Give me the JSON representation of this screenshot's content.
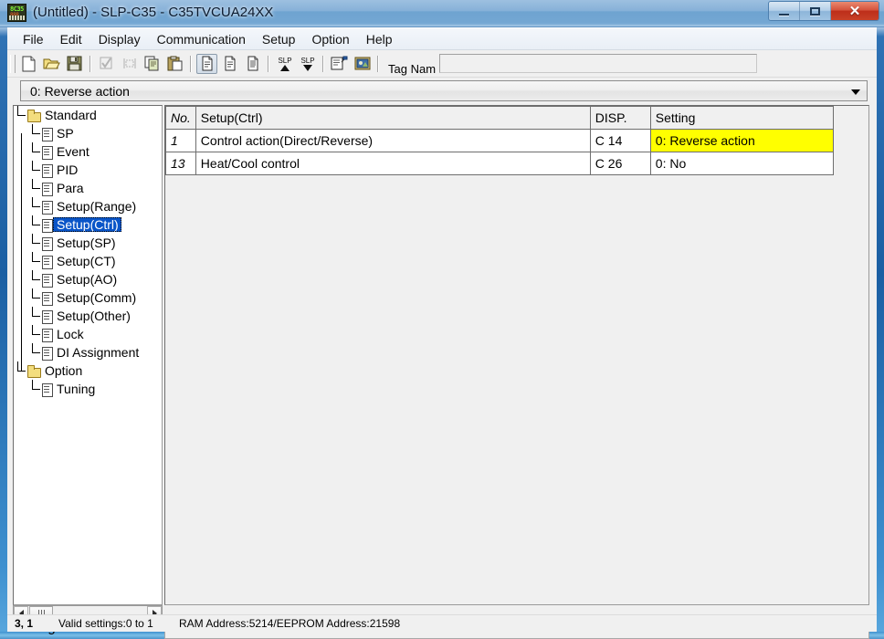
{
  "window": {
    "title": "(Untitled) - SLP-C35 - C35TVCUA24XX",
    "app_icon": "controller-display-icon",
    "icon_digits_top": "8C35",
    "icon_digits_bottom": "888",
    "minimize_label": "",
    "maximize_label": "",
    "close_label": "✕"
  },
  "menu": {
    "items": [
      {
        "label": "File"
      },
      {
        "label": "Edit"
      },
      {
        "label": "Display"
      },
      {
        "label": "Communication"
      },
      {
        "label": "Setup"
      },
      {
        "label": "Option"
      },
      {
        "label": "Help"
      }
    ]
  },
  "toolbar": {
    "buttons": [
      {
        "name": "new-file-icon"
      },
      {
        "name": "open-folder-icon"
      },
      {
        "name": "save-disk-icon"
      },
      {
        "name": "checkbox-icon"
      },
      {
        "name": "select-area-icon"
      },
      {
        "name": "copy-icon"
      },
      {
        "name": "paste-icon"
      },
      {
        "name": "document-active-icon"
      },
      {
        "name": "document-icon"
      },
      {
        "name": "document-lines-icon"
      },
      {
        "name": "slp-upload-icon"
      },
      {
        "name": "slp-download-icon"
      },
      {
        "name": "properties-icon"
      },
      {
        "name": "image-icon"
      }
    ],
    "tag_name_label": "Tag Nam",
    "tag_name_value": "",
    "tag_name_placeholder": ""
  },
  "combo": {
    "selected": "0: Reverse action",
    "arrow_icon": "chevron-down-icon"
  },
  "tree": {
    "nodes": [
      {
        "label": "Standard",
        "type": "folder",
        "level": 0,
        "selected": false
      },
      {
        "label": "SP",
        "type": "doc",
        "level": 1,
        "selected": false
      },
      {
        "label": "Event",
        "type": "doc",
        "level": 1,
        "selected": false
      },
      {
        "label": "PID",
        "type": "doc",
        "level": 1,
        "selected": false
      },
      {
        "label": "Para",
        "type": "doc",
        "level": 1,
        "selected": false
      },
      {
        "label": "Setup(Range)",
        "type": "doc",
        "level": 1,
        "selected": false
      },
      {
        "label": "Setup(Ctrl)",
        "type": "doc",
        "level": 1,
        "selected": true
      },
      {
        "label": "Setup(SP)",
        "type": "doc",
        "level": 1,
        "selected": false
      },
      {
        "label": "Setup(CT)",
        "type": "doc",
        "level": 1,
        "selected": false
      },
      {
        "label": "Setup(AO)",
        "type": "doc",
        "level": 1,
        "selected": false
      },
      {
        "label": "Setup(Comm)",
        "type": "doc",
        "level": 1,
        "selected": false
      },
      {
        "label": "Setup(Other)",
        "type": "doc",
        "level": 1,
        "selected": false
      },
      {
        "label": "Lock",
        "type": "doc",
        "level": 1,
        "selected": false
      },
      {
        "label": "DI Assignment",
        "type": "doc",
        "level": 1,
        "selected": false
      },
      {
        "label": "Option",
        "type": "folder",
        "level": 0,
        "selected": false
      },
      {
        "label": "Tuning",
        "type": "doc",
        "level": 1,
        "selected": false
      }
    ],
    "scrollbar": {
      "left_arrow_icon": "arrow-left-icon",
      "right_arrow_icon": "arrow-right-icon"
    }
  },
  "table": {
    "headers": {
      "no": "No.",
      "name": "Setup(Ctrl)",
      "disp": "DISP.",
      "setting": "Setting"
    },
    "rows": [
      {
        "no": "1",
        "name": "Control action(Direct/Reverse)",
        "disp": "C 14",
        "setting": "0: Reverse action",
        "highlighted": true
      },
      {
        "no": "13",
        "name": "Heat/Cool control",
        "disp": "C 26",
        "setting": "0: No",
        "highlighted": false
      }
    ]
  },
  "bottom": {
    "label": "Setting Selection",
    "field_value": ""
  },
  "status_bar": {
    "coordinates": "3, 1",
    "valid_settings": "Valid settings:0 to 1",
    "addresses": "RAM Address:5214/EEPROM Address:21598"
  },
  "colors": {
    "highlight_yellow": "#FFFF00",
    "selection_blue": "#0A55C8",
    "title_bar_blue": "#86B0D8",
    "close_red": "#D4513B"
  }
}
